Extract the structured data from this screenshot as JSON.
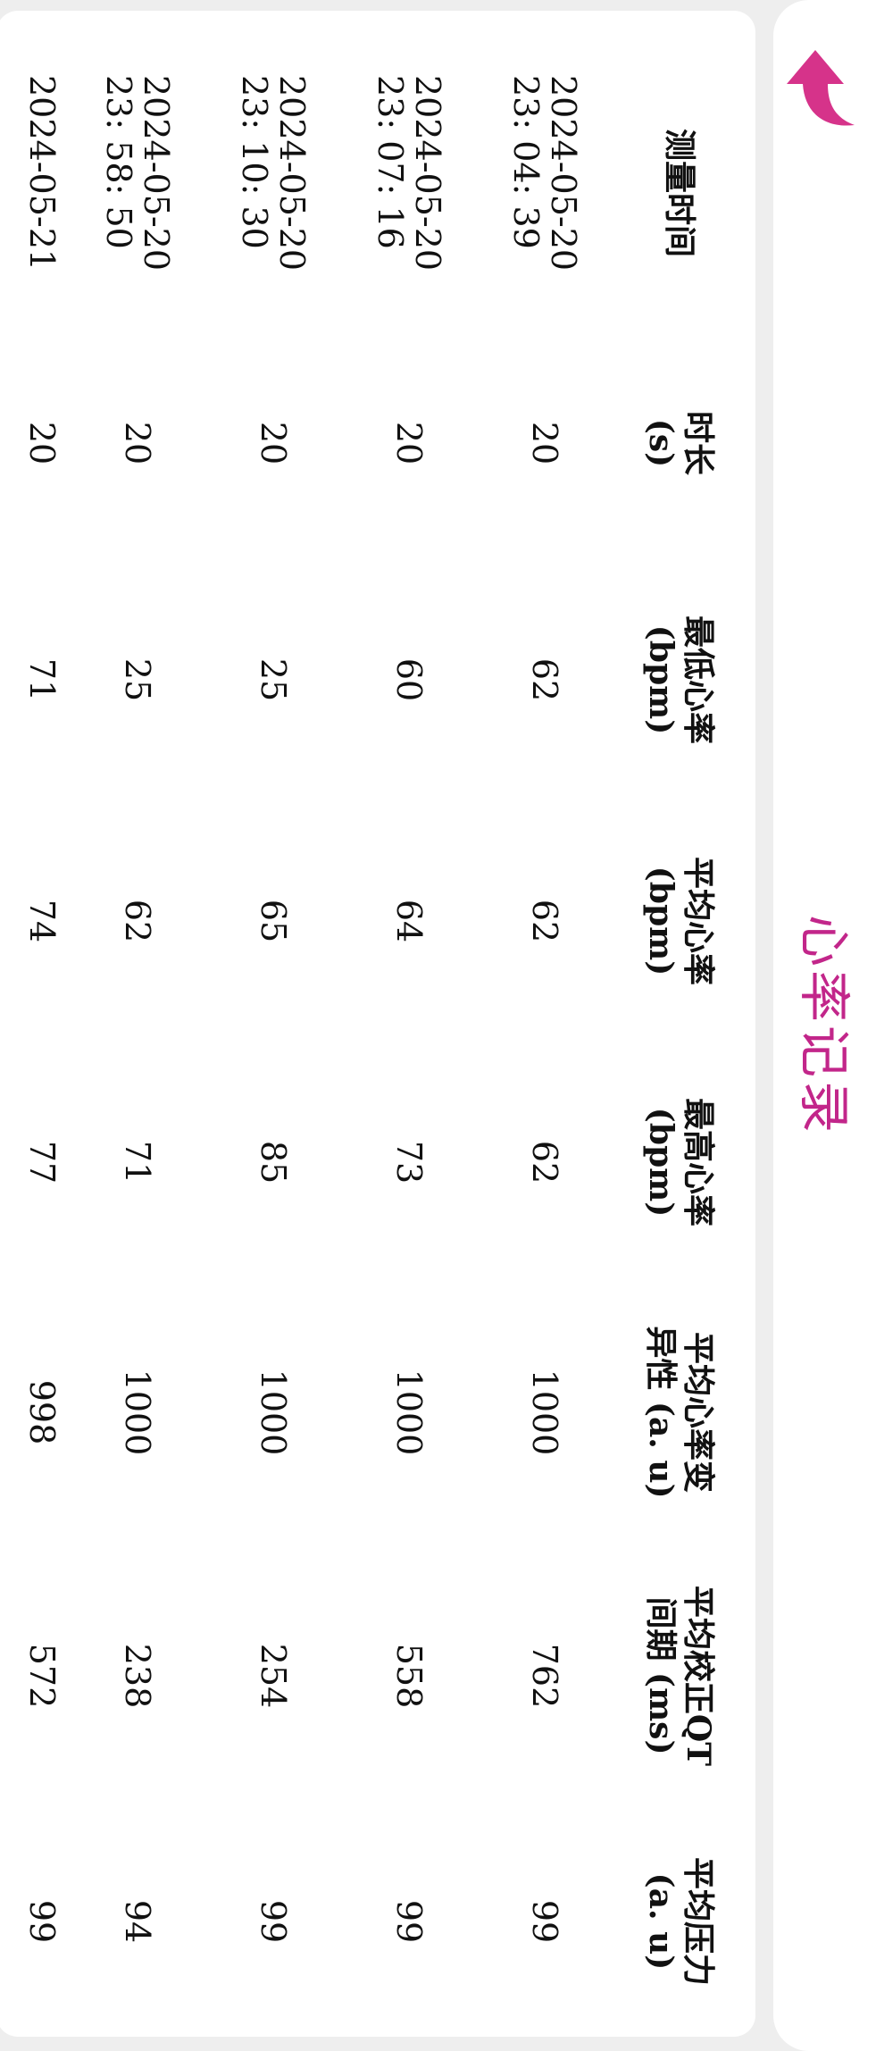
{
  "header": {
    "title": "心率记录",
    "back_icon_color": "#d6338a",
    "title_color": "#c2268a"
  },
  "table": {
    "columns": [
      "测量时间",
      "时长\n(s)",
      "最低心率\n(bpm)",
      "平均心率\n(bpm)",
      "最高心率\n(bpm)",
      "平均心率变\n异性 (a. u)",
      "平均校正QT\n间期 (ms)",
      "平均压力\n(a. u)"
    ],
    "rows": [
      {
        "date": "2024-05-20",
        "time": "23: 04: 39",
        "duration": "20",
        "min_hr": "62",
        "avg_hr": "62",
        "max_hr": "62",
        "hrv": "1000",
        "qtc": "762",
        "stress": "99"
      },
      {
        "date": "2024-05-20",
        "time": "23: 07: 16",
        "duration": "20",
        "min_hr": "60",
        "avg_hr": "64",
        "max_hr": "73",
        "hrv": "1000",
        "qtc": "558",
        "stress": "99"
      },
      {
        "date": "2024-05-20",
        "time": "23: 10: 30",
        "duration": "20",
        "min_hr": "25",
        "avg_hr": "65",
        "max_hr": "85",
        "hrv": "1000",
        "qtc": "254",
        "stress": "99"
      },
      {
        "date": "2024-05-20",
        "time": "23: 58: 50",
        "duration": "20",
        "min_hr": "25",
        "avg_hr": "62",
        "max_hr": "71",
        "hrv": "1000",
        "qtc": "238",
        "stress": "94"
      },
      {
        "date": "2024-05-21",
        "time": "",
        "duration": "20",
        "min_hr": "71",
        "avg_hr": "74",
        "max_hr": "77",
        "hrv": "998",
        "qtc": "572",
        "stress": "99"
      }
    ]
  }
}
